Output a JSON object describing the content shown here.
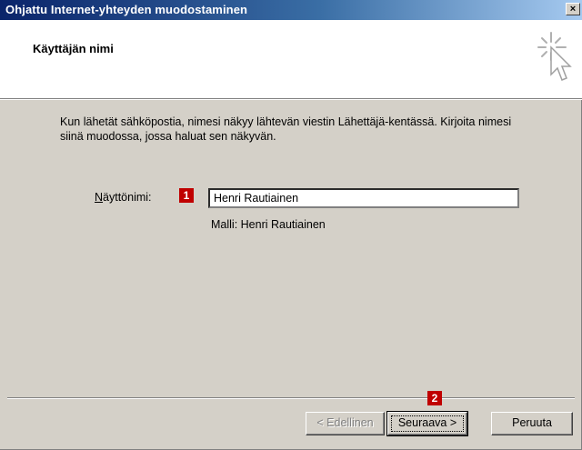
{
  "window": {
    "title": "Ohjattu Internet-yhteyden muodostaminen",
    "close_glyph": "×"
  },
  "header": {
    "title": "Käyttäjän nimi",
    "icon": "wizard-cursor-icon"
  },
  "body": {
    "description": "Kun lähetät sähköpostia, nimesi näkyy lähtevän viestin Lähettäjä-kentässä. Kirjoita nimesi siinä muodossa, jossa haluat sen näkyvän.",
    "field_label": "Näyttönimi:",
    "display_name_value": "Henri Rautiainen",
    "hint": "Malli: Henri Rautiainen"
  },
  "badges": {
    "badge1": "1",
    "badge2": "2"
  },
  "buttons": {
    "back": "< Edellinen",
    "next": "Seuraava >",
    "cancel": "Peruuta"
  },
  "colors": {
    "title_bar_start": "#0a246a",
    "title_bar_end": "#a6caf0",
    "badge": "#c00000",
    "face": "#d4d0c8"
  }
}
